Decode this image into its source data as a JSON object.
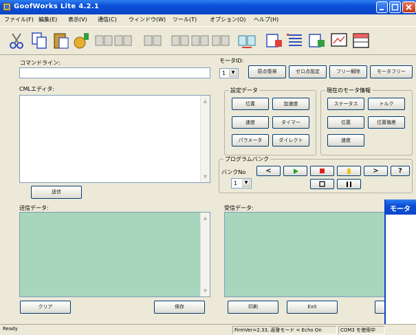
{
  "window": {
    "title": "GoofWorks Lite 4.2.1"
  },
  "menu": [
    "ファイル(F)",
    "編集(E)",
    "表示(V)",
    "通信(C)",
    "ウィンドウ(W)",
    "ツール(T)",
    "オプション(O)",
    "ヘルプ(H)"
  ],
  "toolbar": {
    "icons": [
      "cut-icon",
      "copy-icon",
      "paste-icon",
      "connect-icon",
      "send-1-icon",
      "send-2-icon",
      "send-3-icon",
      "send-4-icon",
      "send-5-icon",
      "send-6-icon",
      "send-all-icon",
      "program-icon",
      "list-icon",
      "program-2-icon",
      "monitor-icon",
      "table-icon"
    ]
  },
  "command_line": {
    "label": "コマンドライン:",
    "value": ""
  },
  "cml_editor": {
    "label": "CMLエディタ:",
    "send_button": "送信"
  },
  "send_data": {
    "label": "送信データ:"
  },
  "recv_data": {
    "label": "受信データ:"
  },
  "motor_id": {
    "label": "モータID:",
    "value": "1"
  },
  "top_buttons": [
    "原点復帰",
    "ゼロ点設定",
    "フリー解除",
    "モータフリー"
  ],
  "settings": {
    "title": "設定データ",
    "buttons": [
      "位置",
      "加速度",
      "速度",
      "タイマー",
      "パラメータ",
      "ダイレクト"
    ]
  },
  "motor_info": {
    "title": "現在のモータ情報",
    "buttons": [
      "ステータス",
      "トルク",
      "位置",
      "位置偏差",
      "速度"
    ]
  },
  "program_bank": {
    "title": "プログラムバンク",
    "bank_label": "バンクNo",
    "bank_value": "1",
    "buttons": [
      "<",
      "▶",
      "■",
      "||",
      ">",
      "?"
    ],
    "colors": {
      "play": "#2aa02a",
      "stop": "#e02020",
      "pause": "#f0c020"
    }
  },
  "bottom_buttons": {
    "clear": "クリア",
    "save": "保存",
    "print": "印刷",
    "exit": "Exit"
  },
  "status": {
    "ready": "Ready",
    "firmware": "FirmVer=2.33, 返答モード = Echo On",
    "port": "COM3 を使用中"
  },
  "overlay": {
    "title": "モータ"
  }
}
